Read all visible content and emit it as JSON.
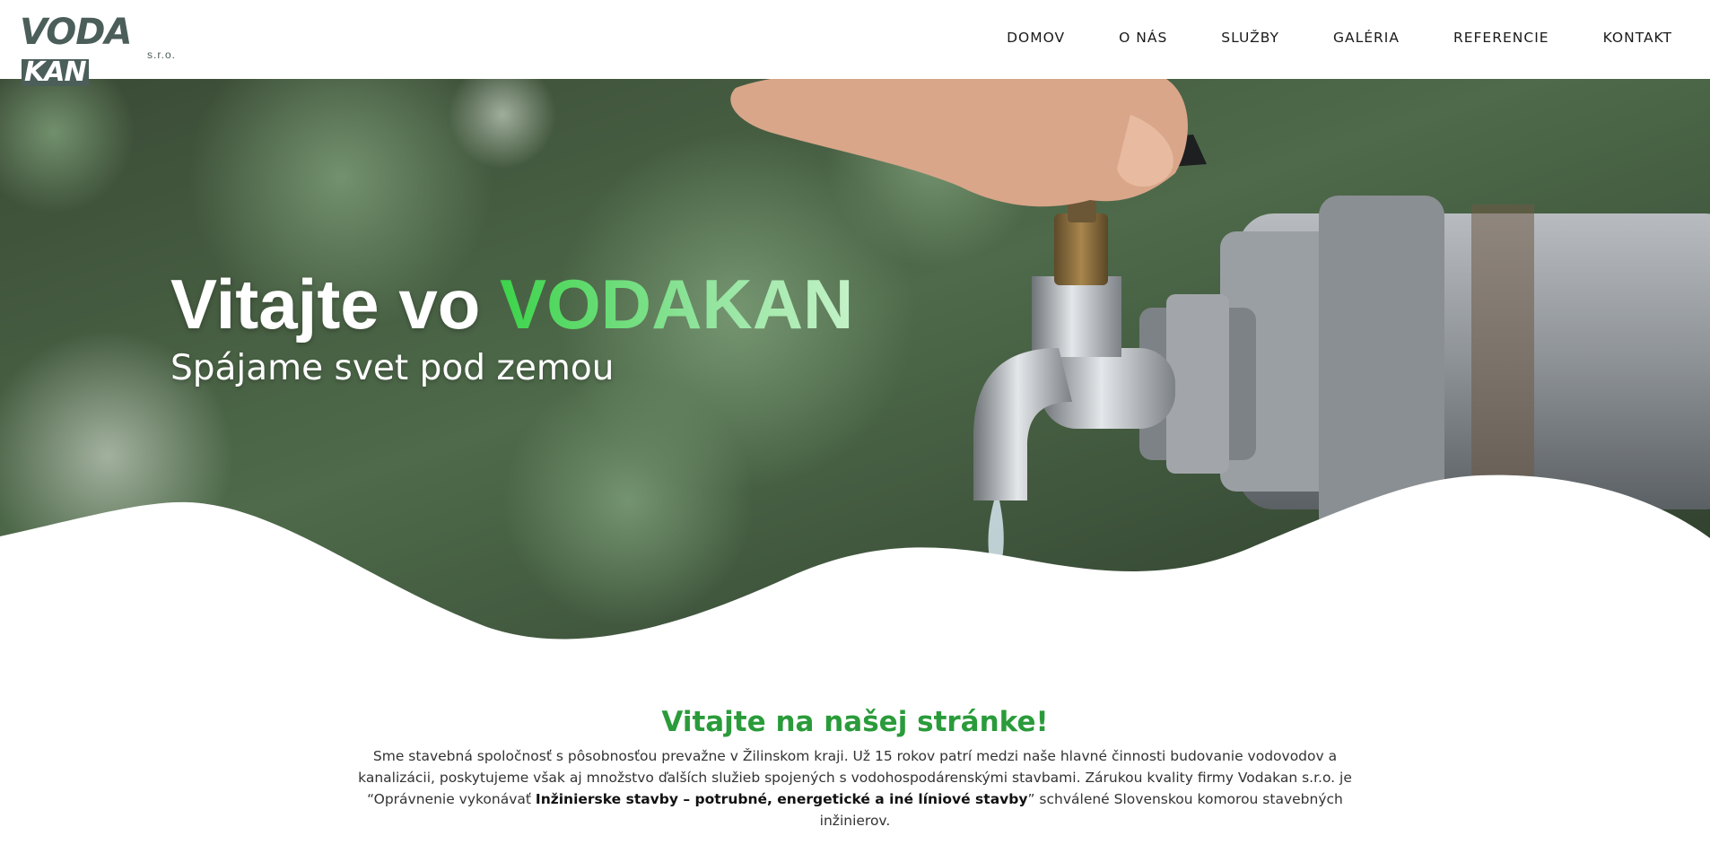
{
  "header": {
    "logo": {
      "wordmark_main": "VODA",
      "wordmark_accent": "KAN",
      "suffix": "s.r.o."
    },
    "nav": [
      {
        "label": "DOMOV"
      },
      {
        "label": "O NÁS"
      },
      {
        "label": "SLUŽBY"
      },
      {
        "label": "GALÉRIA"
      },
      {
        "label": "REFERENCIE"
      },
      {
        "label": "KONTAKT"
      }
    ]
  },
  "hero": {
    "title_prefix": "Vitajte vo ",
    "title_brand": "VODAKAN",
    "subtitle": "Spájame svet pod zemou",
    "brand_gradient": [
      "#3cd44a",
      "#8ee39a",
      "#c4f2c8"
    ]
  },
  "intro": {
    "title": "Vitajte na našej stránke!",
    "text_part1": "Sme stavebná spoločnosť s pôsobnosťou prevažne v Žilinskom kraji. Už 15 rokov patrí medzi naše hlavné činnosti budovanie vodovodov a kanalizácii, poskytujeme však aj množstvo ďalších služieb spojených s vodohospodárenskými stavbami. Zárukou kvality firmy Vodakan s.r.o. je ",
    "text_quote_open": "“",
    "text_quote_plain": "Oprávnenie vykonávať ",
    "text_bold": "Inžinierske stavby – potrubné, energetické a iné líniové stavby",
    "text_quote_close": "”",
    "text_part2": "  schválené Slovenskou komorou stavebných inžinierov."
  },
  "colors": {
    "logo": "#4b5e59",
    "accent_green": "#2a9b3a",
    "nav_text": "#1a1a1a"
  }
}
